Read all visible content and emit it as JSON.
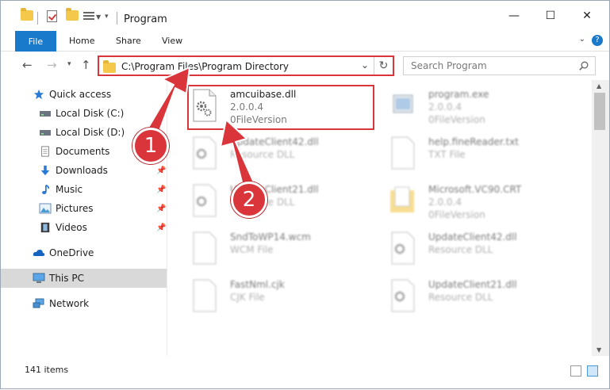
{
  "window": {
    "title": "Program",
    "minimize": "—",
    "maximize": "☐",
    "close": "✕"
  },
  "ribbon": {
    "file": "File",
    "tabs": [
      "Home",
      "Share",
      "View"
    ],
    "help": "?"
  },
  "address": {
    "path": "C:\\Program Files\\Program Directory",
    "search_placeholder": "Search Program"
  },
  "sidebar": {
    "items": [
      {
        "label": "Quick access",
        "icon": "star-icon"
      },
      {
        "label": "Local Disk (C:)",
        "icon": "drive-icon"
      },
      {
        "label": "Local Disk (D:)",
        "icon": "drive-icon"
      },
      {
        "label": "Documents",
        "icon": "documents-icon"
      },
      {
        "label": "Downloads",
        "icon": "download-icon"
      },
      {
        "label": "Music",
        "icon": "music-icon"
      },
      {
        "label": "Pictures",
        "icon": "pictures-icon"
      },
      {
        "label": "Videos",
        "icon": "videos-icon"
      },
      {
        "label": "OneDrive",
        "icon": "cloud-icon"
      },
      {
        "label": "This PC",
        "icon": "computer-icon"
      },
      {
        "label": "Network",
        "icon": "network-icon"
      }
    ]
  },
  "files": [
    {
      "name": "amcuibase.dll",
      "line2": "2.0.0.4",
      "line3": "0FileVersion",
      "icon": "dll-gear-icon"
    },
    {
      "name": "program.exe",
      "line2": "2.0.0.4",
      "line3": "0FileVersion",
      "icon": "exe-icon"
    },
    {
      "name": "UpdateClient42.dll",
      "line2": "Resource DLL",
      "line3": "",
      "icon": "dll-gear-icon"
    },
    {
      "name": "help.fineReader.txt",
      "line2": "TXT File",
      "line3": "",
      "icon": "text-file-icon"
    },
    {
      "name": "UpdateClient21.dll",
      "line2": "Resource DLL",
      "line3": "",
      "icon": "dll-gear-icon"
    },
    {
      "name": "Microsoft.VC90.CRT",
      "line2": "2.0.0.4",
      "line3": "0FileVersion",
      "icon": "folder-icon"
    },
    {
      "name": "SndToWP14.wcm",
      "line2": "WCM File",
      "line3": "",
      "icon": "generic-file-icon"
    },
    {
      "name": "UpdateClient42.dll",
      "line2": "Resource DLL",
      "line3": "",
      "icon": "dll-gear-icon"
    },
    {
      "name": "FastNml.cjk",
      "line2": "CJK File",
      "line3": "",
      "icon": "generic-file-icon"
    },
    {
      "name": "UpdateClient21.dll",
      "line2": "Resource DLL",
      "line3": "",
      "icon": "dll-gear-icon"
    }
  ],
  "status": {
    "count": "141 items"
  },
  "annotations": {
    "step1": "1",
    "step2": "2",
    "color": "#d9353a"
  }
}
